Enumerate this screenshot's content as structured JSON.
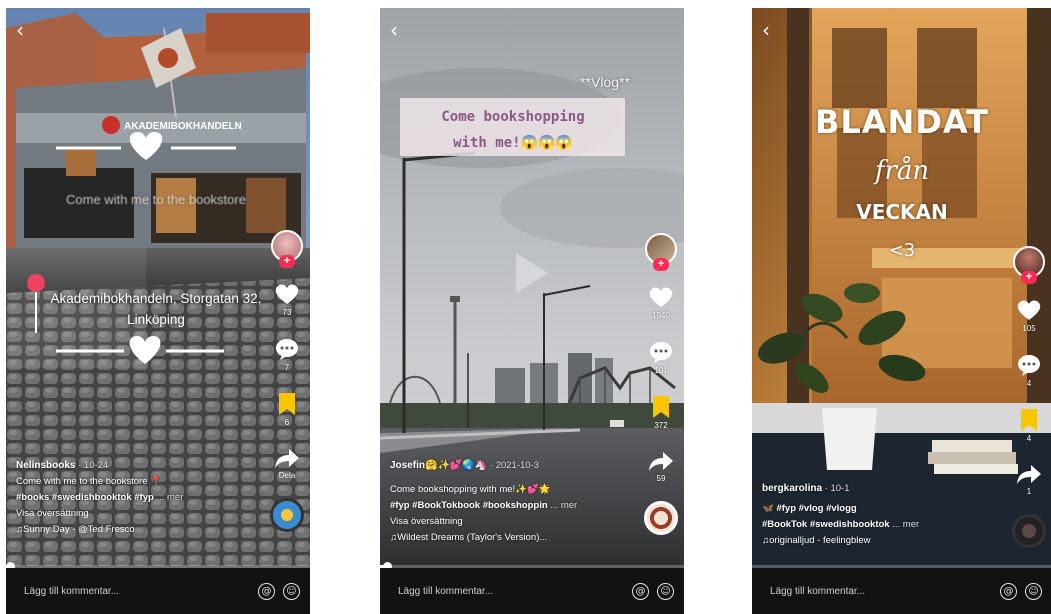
{
  "screens": [
    {
      "back_icon": "chevron-left-icon",
      "overlay": {
        "caption": "Come with me to the bookstore",
        "location": "Akademibokhandeln, Storgatan 32, Linköping",
        "store_sign": "AKADEMIBOKHANDELN"
      },
      "actions": {
        "likes": "73",
        "comments": "7",
        "saves": "6",
        "shares": "Dela"
      },
      "caption": {
        "username": "Nelinsbooks",
        "date": "· 10-24",
        "text": "Come with me to the bookstore 📍",
        "hashtags": "#books #swedishbooktok #fyp",
        "more": "... mer",
        "translate": "Visa översättning",
        "sound": "Sunny Day - @Ted Fresco"
      },
      "progress": 0.01,
      "comment_placeholder": "Lägg till kommentar..."
    },
    {
      "back_icon": "chevron-left-icon",
      "overlay": {
        "vlog": "**Vlog**",
        "line1": "Come bookshopping",
        "line2": "with me!😱😱😱"
      },
      "actions": {
        "likes": "1540",
        "comments": "101",
        "saves": "372",
        "shares": "59"
      },
      "caption": {
        "username": "Josefin🤗✨💕🌏🦄",
        "date": "· 2021-10-3",
        "text": "Come bookshopping with me!✨💕🌟",
        "hashtags": "#fyp #BookTokbook #bookshoppin",
        "more": "... mer",
        "translate": "Visa översättning",
        "sound": "Wildest Dreams (Taylor's Version)..."
      },
      "progress": 0.02,
      "comment_placeholder": "Lägg till kommentar..."
    },
    {
      "back_icon": "chevron-left-icon",
      "overlay": {
        "line1": "BLANDAT",
        "line2": "från",
        "line3": "VECKAN",
        "line4": "<3"
      },
      "actions": {
        "likes": "105",
        "comments": "4",
        "saves": "4",
        "shares": "1"
      },
      "caption": {
        "username": "bergkarolina",
        "date": "· 10-1",
        "text": "🦋 #fyp #vlog #vlogg",
        "hashtags": "#BookTok #swedishbooktok",
        "more": "... mer",
        "sound": "originalljud - feelingblew"
      },
      "progress": 0.0,
      "comment_placeholder": "Lägg till kommentar..."
    }
  ]
}
